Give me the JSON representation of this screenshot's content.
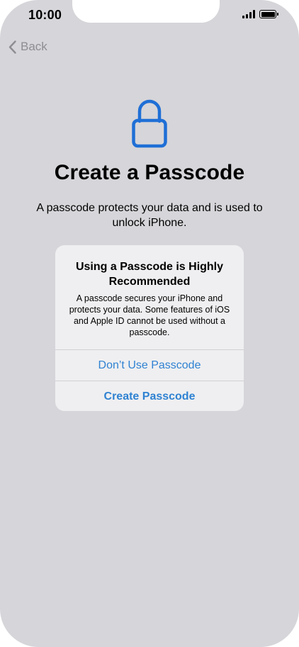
{
  "status_bar": {
    "time": "10:00"
  },
  "nav": {
    "back_label": "Back"
  },
  "page": {
    "title": "Create a Passcode",
    "subtitle": "A passcode protects your data and is used to unlock iPhone."
  },
  "alert": {
    "title": "Using a Passcode is Highly Recommended",
    "message": "A passcode secures your iPhone and protects your data. Some features of iOS and Apple ID cannot be used without a passcode.",
    "buttons": {
      "dont_use": "Don’t Use Passcode",
      "create": "Create Passcode"
    }
  },
  "icons": {
    "lock": "lock-icon",
    "back": "chevron-left-icon",
    "signal": "cellular-signal-icon",
    "battery": "battery-icon"
  },
  "colors": {
    "accent": "#2f82d2",
    "lock_icon": "#1f6fd6",
    "background": "#d6d5d9",
    "alert_background": "#efeff1",
    "back_text": "#8d8d92"
  }
}
